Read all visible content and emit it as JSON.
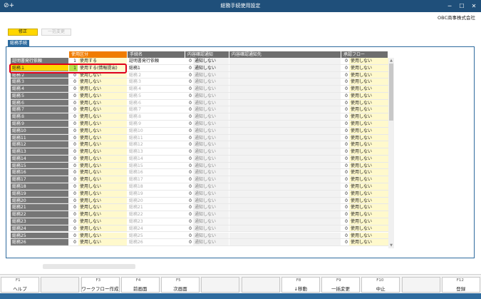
{
  "window": {
    "title": "総務手続使用設定",
    "company": "OBC商事株式会社"
  },
  "toolbar": {
    "fix_label": "修正",
    "bulk_label": "一括変更"
  },
  "tab_label": "総務手続",
  "columns": {
    "use": "使用区分",
    "name": "手続名",
    "check": "内容確認通知",
    "dest": "内容確認通知先",
    "flow": "承認フロー"
  },
  "rows": [
    {
      "name": "証明書発行依頼",
      "num": "1",
      "use": "使用する",
      "fn": "証明書発行依頼",
      "cnum": "0",
      "chk": "通知しない",
      "fnum": "0",
      "flow": "使用しない"
    },
    {
      "name": "総務１",
      "num": "1",
      "use": "使用する(情報提出)",
      "fn": "総務1",
      "cnum": "0",
      "chk": "通知しない",
      "fnum": "0",
      "flow": "使用しない"
    },
    {
      "name": "総務２",
      "num": "0",
      "use": "使用しない",
      "fn": "総務２",
      "cnum": "0",
      "chk": "通知しない",
      "fnum": "0",
      "flow": "使用しない"
    },
    {
      "name": "総務３",
      "num": "0",
      "use": "使用しない",
      "fn": "総務３",
      "cnum": "0",
      "chk": "通知しない",
      "fnum": "0",
      "flow": "使用しない"
    },
    {
      "name": "総務４",
      "num": "0",
      "use": "使用しない",
      "fn": "総務４",
      "cnum": "0",
      "chk": "通知しない",
      "fnum": "0",
      "flow": "使用しない"
    },
    {
      "name": "総務５",
      "num": "0",
      "use": "使用しない",
      "fn": "総務５",
      "cnum": "0",
      "chk": "通知しない",
      "fnum": "0",
      "flow": "使用しない"
    },
    {
      "name": "総務６",
      "num": "0",
      "use": "使用しない",
      "fn": "総務６",
      "cnum": "0",
      "chk": "通知しない",
      "fnum": "0",
      "flow": "使用しない"
    },
    {
      "name": "総務７",
      "num": "0",
      "use": "使用しない",
      "fn": "総務７",
      "cnum": "0",
      "chk": "通知しない",
      "fnum": "0",
      "flow": "使用しない"
    },
    {
      "name": "総務８",
      "num": "0",
      "use": "使用しない",
      "fn": "総務８",
      "cnum": "0",
      "chk": "通知しない",
      "fnum": "0",
      "flow": "使用しない"
    },
    {
      "name": "総務９",
      "num": "0",
      "use": "使用しない",
      "fn": "総務９",
      "cnum": "0",
      "chk": "通知しない",
      "fnum": "0",
      "flow": "使用しない"
    },
    {
      "name": "総務10",
      "num": "0",
      "use": "使用しない",
      "fn": "総務10",
      "cnum": "0",
      "chk": "通知しない",
      "fnum": "0",
      "flow": "使用しない"
    },
    {
      "name": "総務11",
      "num": "0",
      "use": "使用しない",
      "fn": "総務11",
      "cnum": "0",
      "chk": "通知しない",
      "fnum": "0",
      "flow": "使用しない"
    },
    {
      "name": "総務12",
      "num": "0",
      "use": "使用しない",
      "fn": "総務12",
      "cnum": "0",
      "chk": "通知しない",
      "fnum": "0",
      "flow": "使用しない"
    },
    {
      "name": "総務13",
      "num": "0",
      "use": "使用しない",
      "fn": "総務13",
      "cnum": "0",
      "chk": "通知しない",
      "fnum": "0",
      "flow": "使用しない"
    },
    {
      "name": "総務14",
      "num": "0",
      "use": "使用しない",
      "fn": "総務14",
      "cnum": "0",
      "chk": "通知しない",
      "fnum": "0",
      "flow": "使用しない"
    },
    {
      "name": "総務15",
      "num": "0",
      "use": "使用しない",
      "fn": "総務15",
      "cnum": "0",
      "chk": "通知しない",
      "fnum": "0",
      "flow": "使用しない"
    },
    {
      "name": "総務16",
      "num": "0",
      "use": "使用しない",
      "fn": "総務16",
      "cnum": "0",
      "chk": "通知しない",
      "fnum": "0",
      "flow": "使用しない"
    },
    {
      "name": "総務17",
      "num": "0",
      "use": "使用しない",
      "fn": "総務17",
      "cnum": "0",
      "chk": "通知しない",
      "fnum": "0",
      "flow": "使用しない"
    },
    {
      "name": "総務18",
      "num": "0",
      "use": "使用しない",
      "fn": "総務18",
      "cnum": "0",
      "chk": "通知しない",
      "fnum": "0",
      "flow": "使用しない"
    },
    {
      "name": "総務19",
      "num": "0",
      "use": "使用しない",
      "fn": "総務19",
      "cnum": "0",
      "chk": "通知しない",
      "fnum": "0",
      "flow": "使用しない"
    },
    {
      "name": "総務20",
      "num": "0",
      "use": "使用しない",
      "fn": "総務20",
      "cnum": "0",
      "chk": "通知しない",
      "fnum": "0",
      "flow": "使用しない"
    },
    {
      "name": "総務21",
      "num": "0",
      "use": "使用しない",
      "fn": "総務21",
      "cnum": "0",
      "chk": "通知しない",
      "fnum": "0",
      "flow": "使用しない"
    },
    {
      "name": "総務22",
      "num": "0",
      "use": "使用しない",
      "fn": "総務22",
      "cnum": "0",
      "chk": "通知しない",
      "fnum": "0",
      "flow": "使用しない"
    },
    {
      "name": "総務23",
      "num": "0",
      "use": "使用しない",
      "fn": "総務23",
      "cnum": "0",
      "chk": "通知しない",
      "fnum": "0",
      "flow": "使用しない"
    },
    {
      "name": "総務24",
      "num": "0",
      "use": "使用しない",
      "fn": "総務24",
      "cnum": "0",
      "chk": "通知しない",
      "fnum": "0",
      "flow": "使用しない"
    },
    {
      "name": "総務25",
      "num": "0",
      "use": "使用しない",
      "fn": "総務25",
      "cnum": "0",
      "chk": "通知しない",
      "fnum": "0",
      "flow": "使用しない"
    },
    {
      "name": "総務26",
      "num": "0",
      "use": "使用しない",
      "fn": "総務26",
      "cnum": "0",
      "chk": "通知しない",
      "fnum": "0",
      "flow": "使用しない"
    }
  ],
  "fkeys": [
    {
      "key": "F1",
      "label": "ヘルプ"
    },
    {
      "key": "",
      "label": ""
    },
    {
      "key": "F3",
      "label": "ワークフロー作成"
    },
    {
      "key": "F4",
      "label": "前画面"
    },
    {
      "key": "F5",
      "label": "次画面"
    },
    {
      "key": "",
      "label": ""
    },
    {
      "key": "",
      "label": ""
    },
    {
      "key": "F8",
      "label": "↓移動"
    },
    {
      "key": "F9",
      "label": "一括変更"
    },
    {
      "key": "F10",
      "label": "中止"
    },
    {
      "key": "",
      "label": ""
    },
    {
      "key": "F12",
      "label": "登録"
    }
  ]
}
